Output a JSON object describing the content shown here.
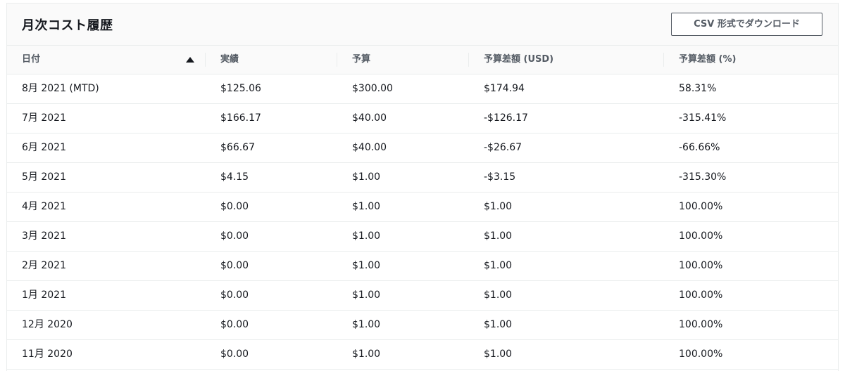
{
  "panel": {
    "title": "月次コスト履歴",
    "csv_button_label": "CSV 形式でダウンロード"
  },
  "table": {
    "columns": [
      "日付",
      "実績",
      "予算",
      "予算差額 (USD)",
      "予算差額 (%)"
    ],
    "sort": {
      "column": "日付",
      "direction": "ascending",
      "icon": "sort-up-triangle-icon"
    },
    "rows": [
      [
        "8月 2021 (MTD)",
        "$125.06",
        "$300.00",
        "$174.94",
        "58.31%"
      ],
      [
        "7月 2021",
        "$166.17",
        "$40.00",
        "-$126.17",
        "-315.41%"
      ],
      [
        "6月 2021",
        "$66.67",
        "$40.00",
        "-$26.67",
        "-66.66%"
      ],
      [
        "5月 2021",
        "$4.15",
        "$1.00",
        "-$3.15",
        "-315.30%"
      ],
      [
        "4月 2021",
        "$0.00",
        "$1.00",
        "$1.00",
        "100.00%"
      ],
      [
        "3月 2021",
        "$0.00",
        "$1.00",
        "$1.00",
        "100.00%"
      ],
      [
        "2月 2021",
        "$0.00",
        "$1.00",
        "$1.00",
        "100.00%"
      ],
      [
        "1月 2021",
        "$0.00",
        "$1.00",
        "$1.00",
        "100.00%"
      ],
      [
        "12月 2020",
        "$0.00",
        "$1.00",
        "$1.00",
        "100.00%"
      ],
      [
        "11月 2020",
        "$0.00",
        "$1.00",
        "$1.00",
        "100.00%"
      ]
    ]
  },
  "colors": {
    "text": "#16191f",
    "header_text": "#545b64",
    "border": "#eaeded",
    "header_bg": "#fafafa"
  }
}
